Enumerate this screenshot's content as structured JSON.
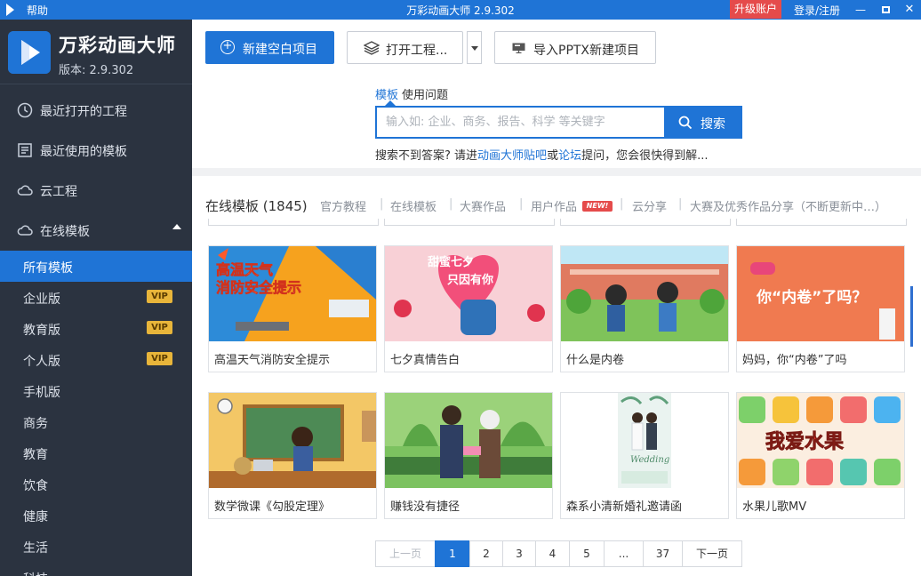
{
  "window": {
    "help_menu": "帮助",
    "title": "万彩动画大师 2.9.302",
    "upgrade_label": "升级账户",
    "login_label": "登录/注册"
  },
  "sidebar": {
    "app_name": "万彩动画大师",
    "version": "版本: 2.9.302",
    "main_items": [
      {
        "label": "最近打开的工程",
        "icon": "clock-icon"
      },
      {
        "label": "最近使用的模板",
        "icon": "template-icon"
      },
      {
        "label": "云工程",
        "icon": "cloud-icon"
      },
      {
        "label": "在线模板",
        "icon": "cloud-icon"
      }
    ],
    "sub_items": [
      {
        "label": "所有模板",
        "vip": false,
        "active": true
      },
      {
        "label": "企业版",
        "vip": true
      },
      {
        "label": "教育版",
        "vip": true
      },
      {
        "label": "个人版",
        "vip": true
      },
      {
        "label": "手机版",
        "vip": false
      },
      {
        "label": "商务",
        "vip": false
      },
      {
        "label": "教育",
        "vip": false
      },
      {
        "label": "饮食",
        "vip": false
      },
      {
        "label": "健康",
        "vip": false
      },
      {
        "label": "生活",
        "vip": false
      },
      {
        "label": "科技",
        "vip": false
      }
    ],
    "vip_label": "VIP"
  },
  "toolbar": {
    "new_project": "新建空白项目",
    "open_project": "打开工程...",
    "import_pptx": "导入PPTX新建项目"
  },
  "search": {
    "tab_templates": "模板",
    "tab_questions": "使用问题",
    "placeholder": "输入如: 企业、商务、报告、科学 等关键字",
    "button": "搜索",
    "hint_prefix": "搜索不到答案? 请进",
    "hint_link1": "动画大师贴吧",
    "hint_or": "或",
    "hint_link2": "论坛",
    "hint_suffix": "提问，您会很快得到解..."
  },
  "categories": {
    "title": "在线模板 (1845)",
    "items": [
      "官方教程",
      "在线模板",
      "大赛作品",
      "用户作品",
      "云分享",
      "大赛及优秀作品分享（不断更新中…）"
    ],
    "new_badge": "NEW!"
  },
  "templates": [
    {
      "title": "高温天气消防安全提示",
      "thumb_text": "高温天气 消防安全提示"
    },
    {
      "title": "七夕真情告白",
      "thumb_text": "甜蜜七夕 只因有你"
    },
    {
      "title": "什么是内卷",
      "thumb_text": ""
    },
    {
      "title": "妈妈，你“内卷”了吗",
      "thumb_text": "你“内卷”了吗？"
    },
    {
      "title": "数学微课《勾股定理》",
      "thumb_text": ""
    },
    {
      "title": "赚钱没有捷径",
      "thumb_text": ""
    },
    {
      "title": "森系小清新婚礼邀请函",
      "thumb_text": "Wedding"
    },
    {
      "title": "水果儿歌MV",
      "thumb_text": "我爱水果"
    }
  ],
  "pagination": {
    "prev": "上一页",
    "pages": [
      "1",
      "2",
      "3",
      "4",
      "5",
      "...",
      "37"
    ],
    "current": "1",
    "next": "下一页"
  },
  "colors": {
    "accent": "#1f74d6",
    "sidebar_bg": "#2b3340",
    "upgrade_red": "#e54b4b",
    "vip_gold": "#e8b53a"
  }
}
